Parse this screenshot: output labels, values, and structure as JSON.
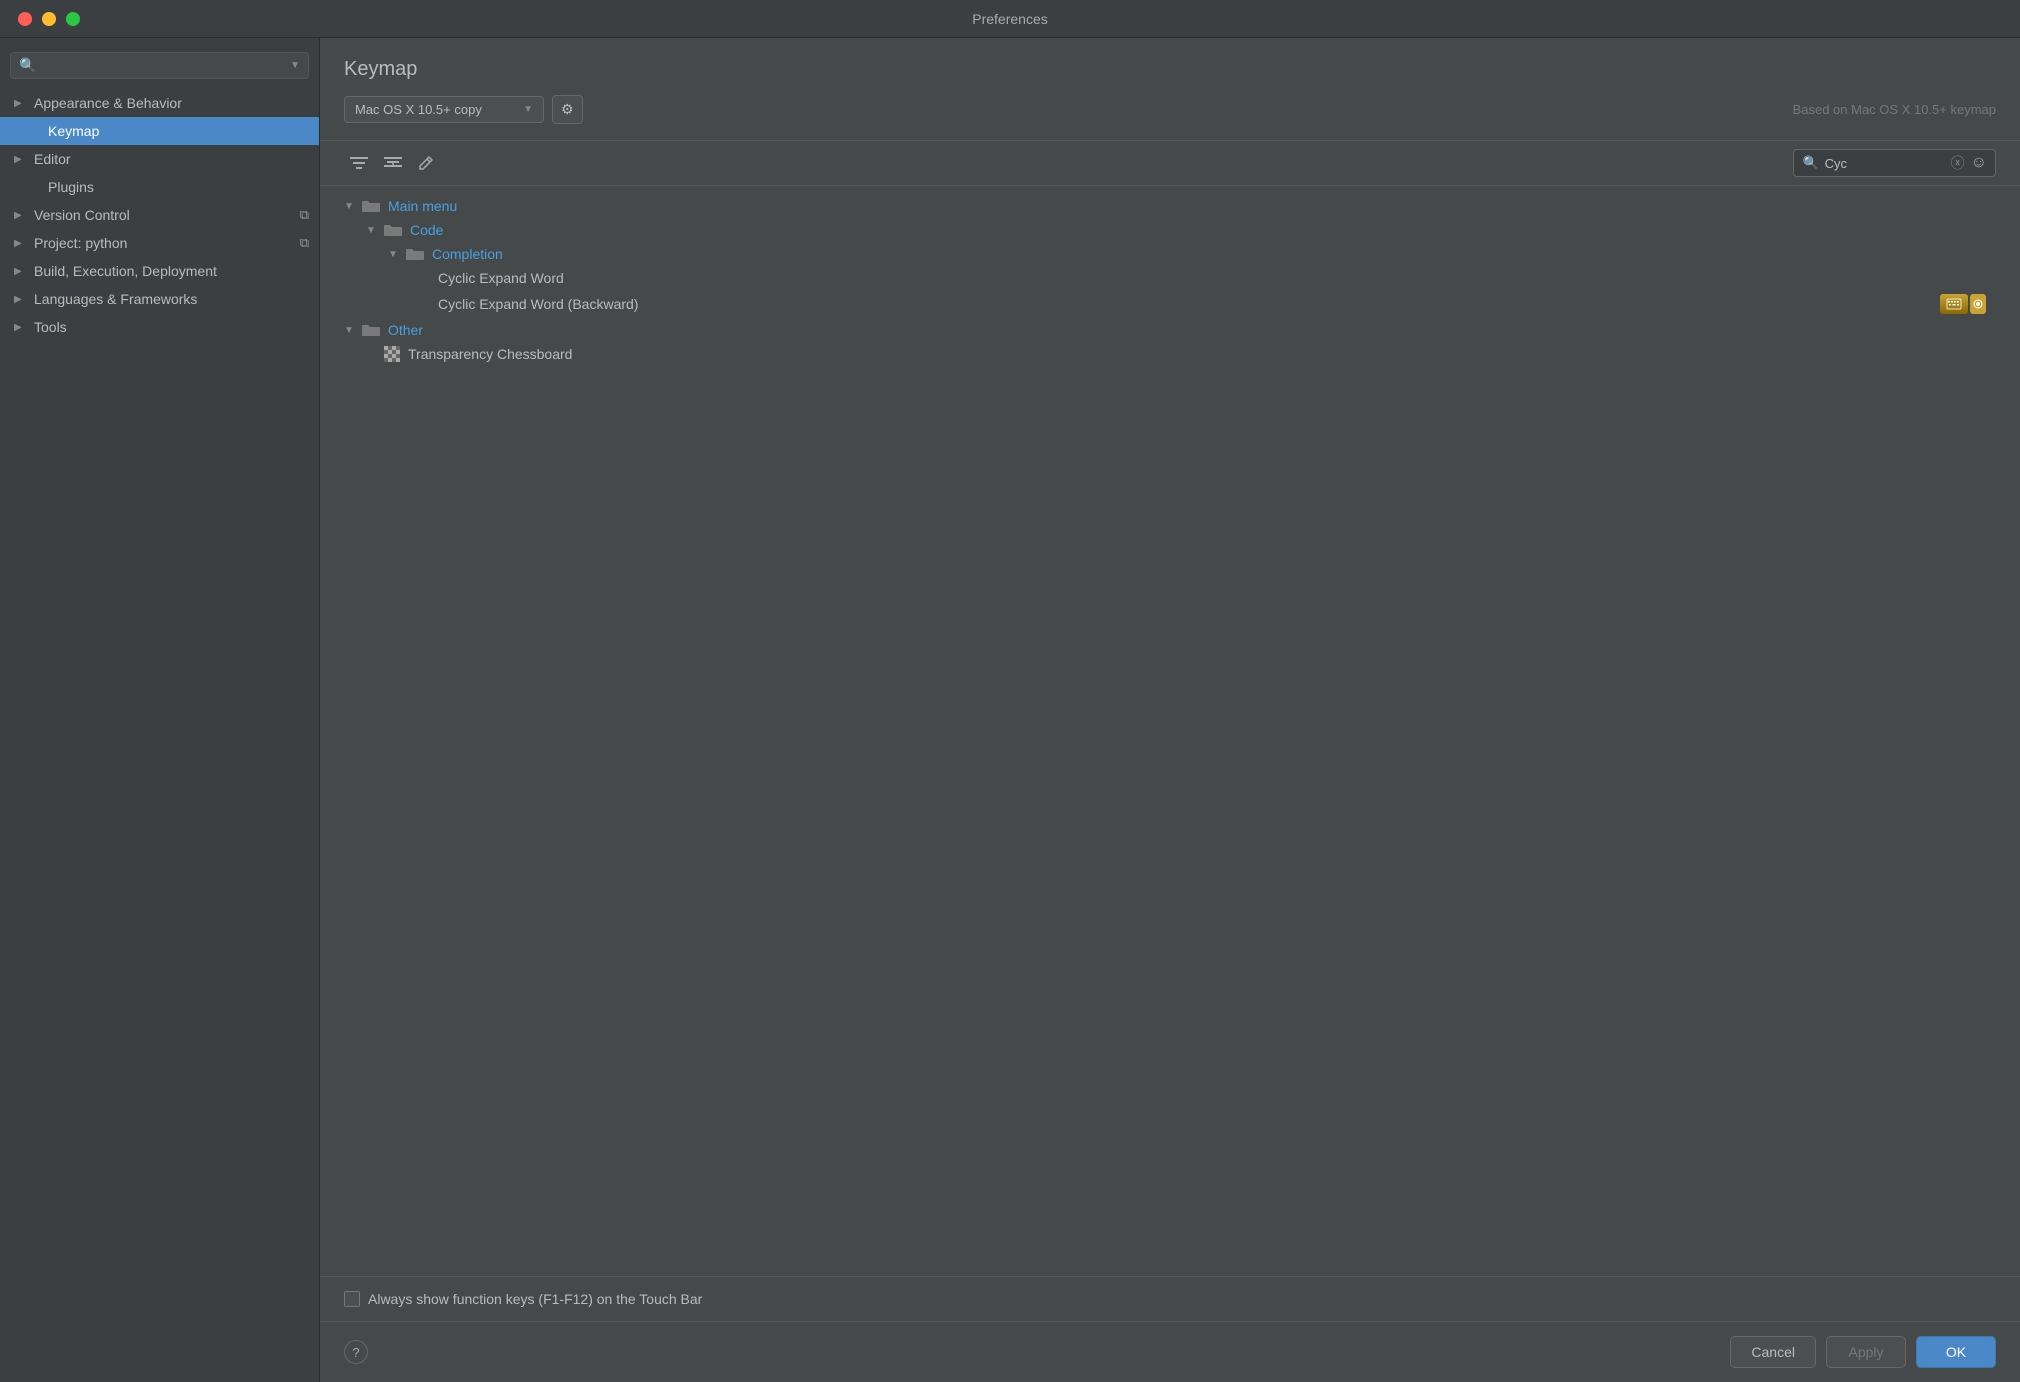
{
  "window": {
    "title": "Preferences"
  },
  "sidebar": {
    "search_placeholder": "",
    "items": [
      {
        "id": "appearance-behavior",
        "label": "Appearance & Behavior",
        "indent": 0,
        "arrow": "▶",
        "active": false,
        "has_copy": false
      },
      {
        "id": "keymap",
        "label": "Keymap",
        "indent": 1,
        "arrow": "",
        "active": true,
        "has_copy": false
      },
      {
        "id": "editor",
        "label": "Editor",
        "indent": 0,
        "arrow": "▶",
        "active": false,
        "has_copy": false
      },
      {
        "id": "plugins",
        "label": "Plugins",
        "indent": 1,
        "arrow": "",
        "active": false,
        "has_copy": false
      },
      {
        "id": "version-control",
        "label": "Version Control",
        "indent": 0,
        "arrow": "▶",
        "active": false,
        "has_copy": true
      },
      {
        "id": "project-python",
        "label": "Project: python",
        "indent": 0,
        "arrow": "▶",
        "active": false,
        "has_copy": true
      },
      {
        "id": "build-execution-deployment",
        "label": "Build, Execution, Deployment",
        "indent": 0,
        "arrow": "▶",
        "active": false,
        "has_copy": false
      },
      {
        "id": "languages-frameworks",
        "label": "Languages & Frameworks",
        "indent": 0,
        "arrow": "▶",
        "active": false,
        "has_copy": false
      },
      {
        "id": "tools",
        "label": "Tools",
        "indent": 0,
        "arrow": "▶",
        "active": false,
        "has_copy": false
      }
    ]
  },
  "content": {
    "title": "Keymap",
    "keymap_name": "Mac OS X 10.5+ copy",
    "based_on": "Based on Mac OS X 10.5+ keymap",
    "search_value": "Cyc",
    "toolbar": {
      "filter_icon": "☰",
      "filter2_icon": "⚌",
      "edit_icon": "✎"
    },
    "tree": {
      "items": [
        {
          "id": "main-menu",
          "label": "Main menu",
          "type": "folder",
          "indent": 0,
          "expanded": true,
          "toggle": "▼"
        },
        {
          "id": "code",
          "label": "Code",
          "type": "folder",
          "indent": 1,
          "expanded": true,
          "toggle": "▼"
        },
        {
          "id": "completion",
          "label": "Completion",
          "type": "folder",
          "indent": 2,
          "expanded": true,
          "toggle": "▼"
        },
        {
          "id": "cyclic-expand-word",
          "label": "Cyclic Expand Word",
          "type": "leaf",
          "indent": 3,
          "toggle": ""
        },
        {
          "id": "cyclic-expand-word-backward",
          "label": "Cyclic Expand Word (Backward)",
          "type": "leaf",
          "indent": 3,
          "toggle": "",
          "has_special": true
        },
        {
          "id": "other",
          "label": "Other",
          "type": "folder",
          "indent": 0,
          "expanded": true,
          "toggle": "▼"
        },
        {
          "id": "transparency-chessboard",
          "label": "Transparency Chessboard",
          "type": "grid-leaf",
          "indent": 1,
          "toggle": ""
        }
      ]
    },
    "bottom": {
      "checkbox_label": "Always show function keys (F1-F12) on the Touch Bar"
    },
    "footer": {
      "help_label": "?",
      "cancel_label": "Cancel",
      "apply_label": "Apply",
      "ok_label": "OK"
    }
  }
}
